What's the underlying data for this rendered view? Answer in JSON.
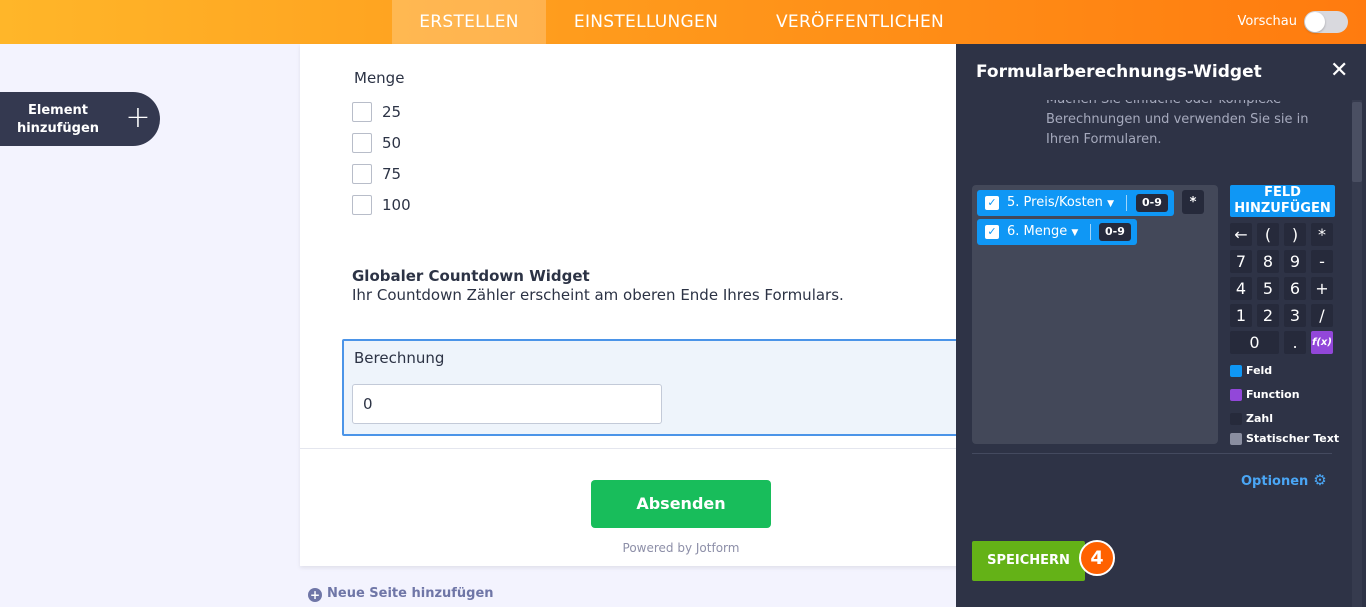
{
  "nav": {
    "tabs": [
      {
        "label": "ERSTELLEN",
        "active": true
      },
      {
        "label": "EINSTELLUNGEN",
        "active": false
      },
      {
        "label": "VERÖFFENTLICHEN",
        "active": false
      }
    ],
    "preview_label": "Vorschau",
    "preview_on": false
  },
  "sidebar": {
    "add_element_label": "Element hinzufügen",
    "add_element_icon": "plus-icon"
  },
  "form": {
    "quantity_label": "Menge",
    "quantity_options": [
      "25",
      "50",
      "75",
      "100"
    ],
    "countdown_title": "Globaler Countdown Widget",
    "countdown_desc": "Ihr Countdown Zähler erscheint am oberen Ende Ihres Formulars.",
    "calc_label": "Berechnung",
    "calc_value": "0",
    "submit_label": "Absenden",
    "powered_by": "Powered by Jotform",
    "new_page_label": "Neue Seite hinzufügen"
  },
  "panel": {
    "title": "Formularberechnungs-Widget",
    "close_icon": "close-icon",
    "description": "Machen Sie einfache oder komplexe Berechnungen und verwenden Sie sie in Ihren Formularen.",
    "formula_fields": [
      {
        "label": "5. Preis/Kosten",
        "range": "0-9"
      },
      {
        "label": "6. Menge",
        "range": "0-9"
      }
    ],
    "formula_operator": "*",
    "add_field_label": "FELD HINZUFÜGEN",
    "keypad": [
      [
        "←",
        "(",
        ")",
        "*"
      ],
      [
        "7",
        "8",
        "9",
        "-"
      ],
      [
        "4",
        "5",
        "6",
        "+"
      ],
      [
        "1",
        "2",
        "3",
        "/"
      ],
      [
        "0",
        ".",
        "f(x)"
      ]
    ],
    "legend": [
      {
        "label": "Feld",
        "color": "#0f97f5"
      },
      {
        "label": "Function",
        "color": "#9247d9"
      },
      {
        "label": "Zahl",
        "color": "#262a3b"
      },
      {
        "label": "Statischer Text",
        "color": "#8a8ea0"
      }
    ],
    "options_label": "Optionen",
    "save_label": "SPEICHERN",
    "step_number": "4"
  }
}
